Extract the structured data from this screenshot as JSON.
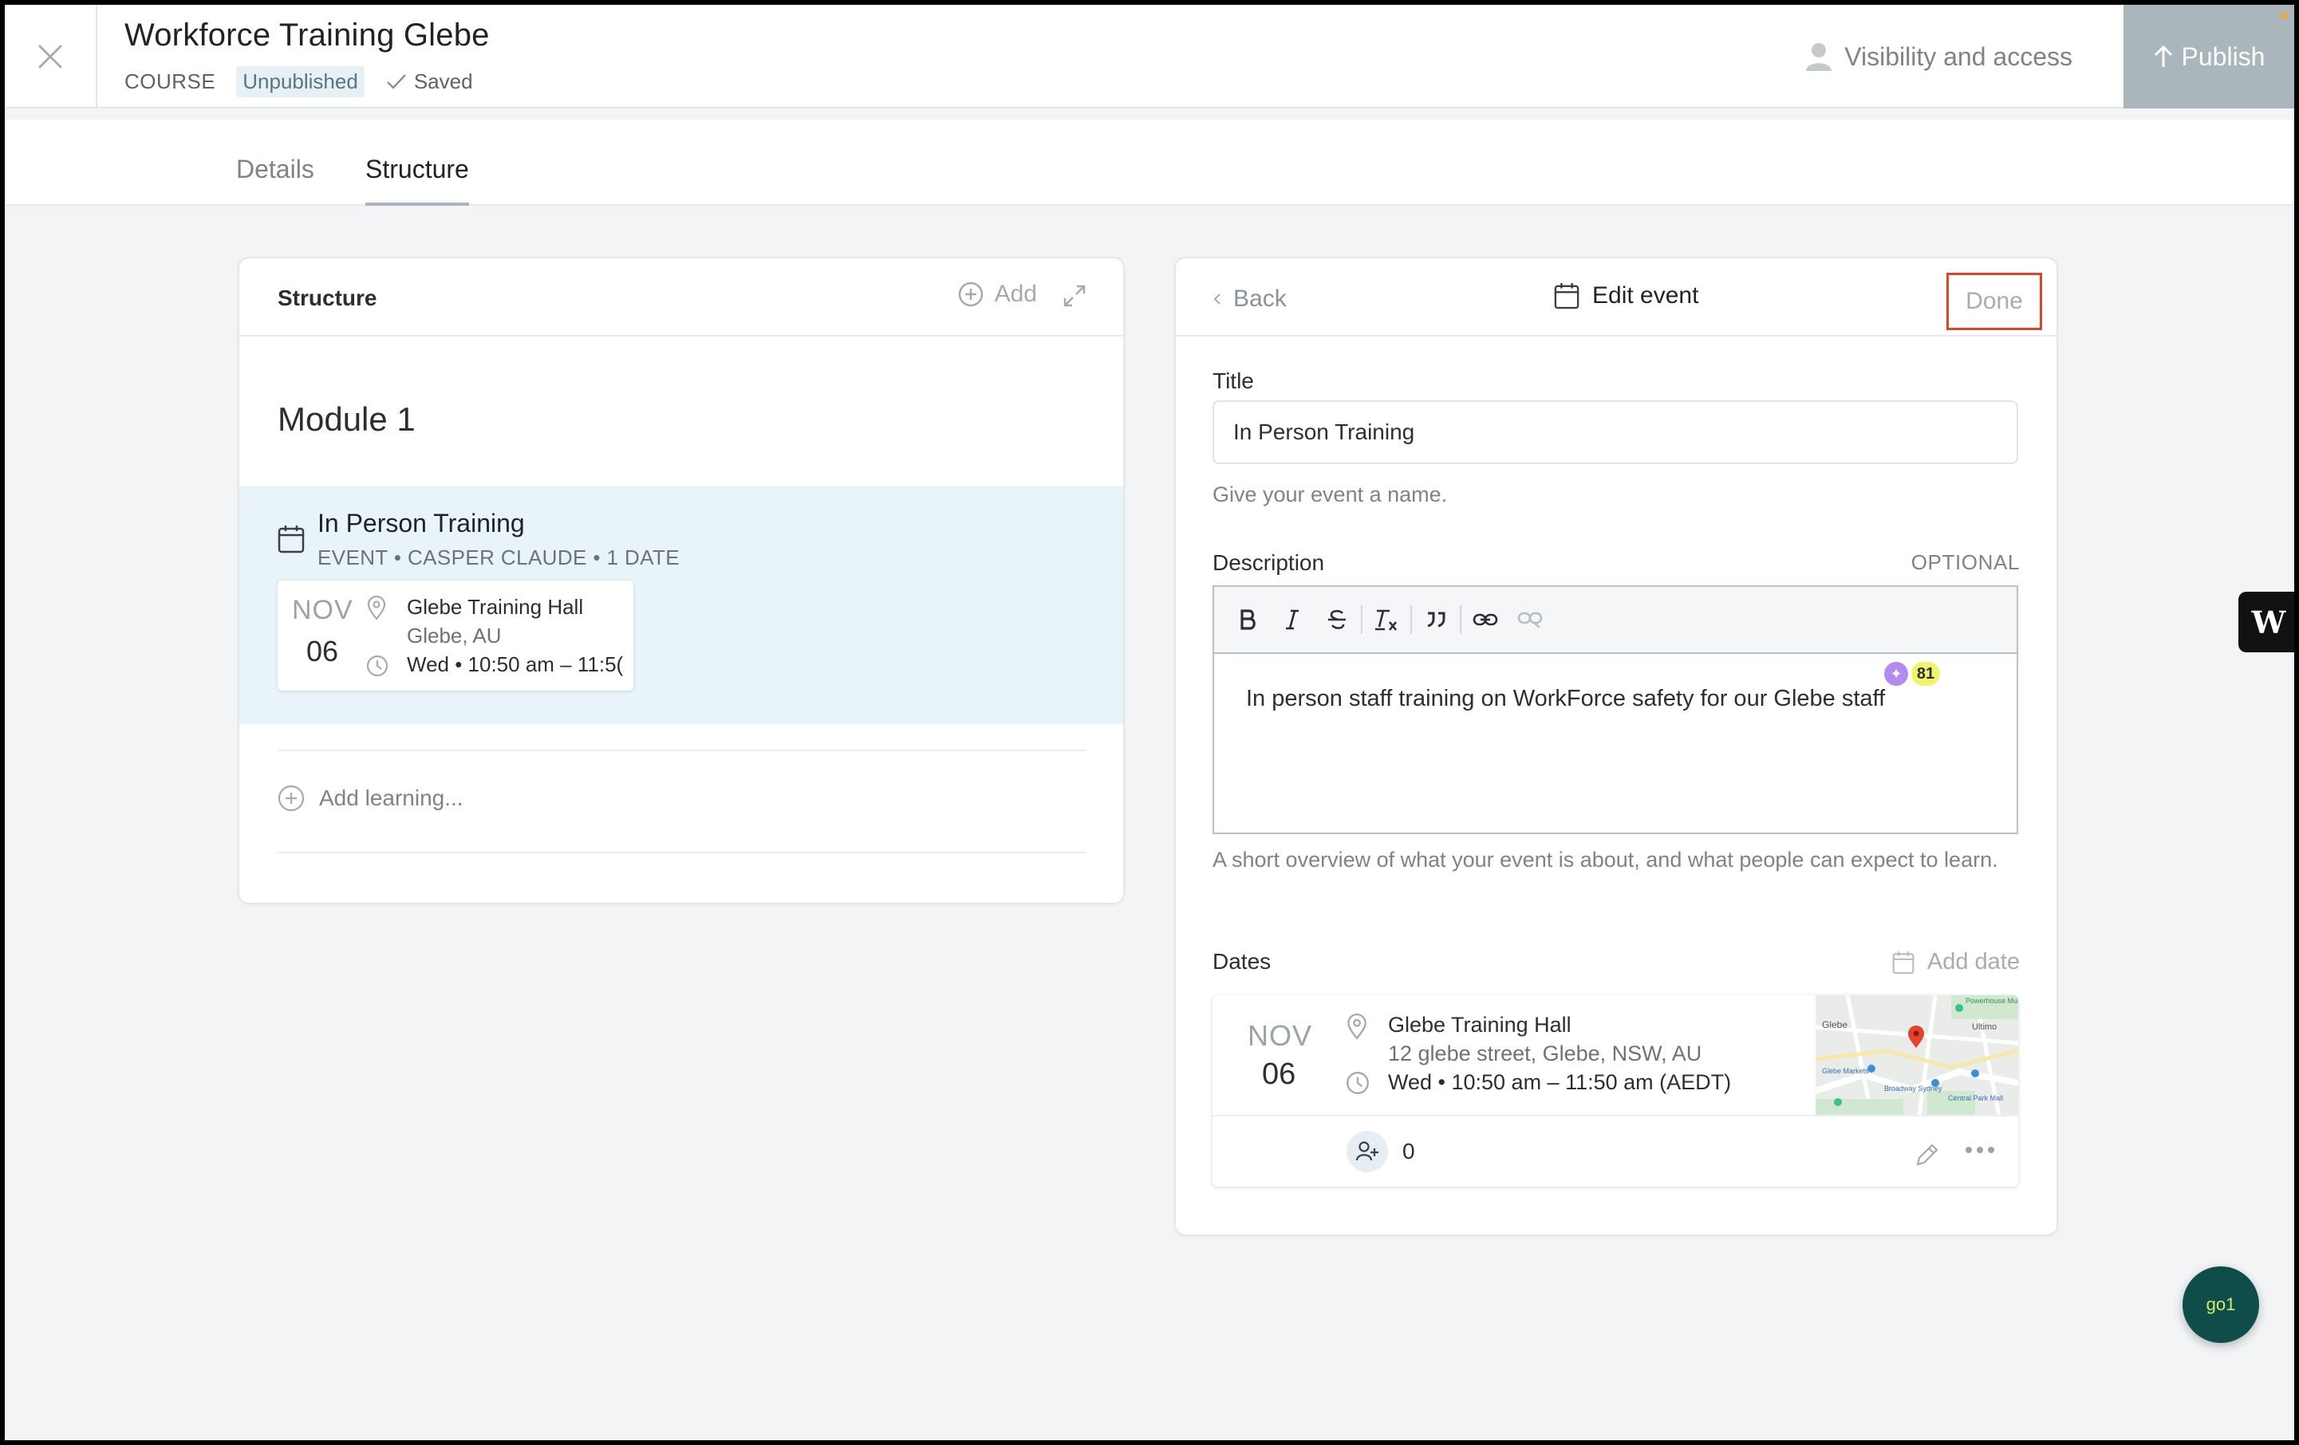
{
  "header": {
    "title": "Workforce Training Glebe",
    "type_label": "COURSE",
    "status": "Unpublished",
    "saved_label": "Saved",
    "visibility_label": "Visibility and access",
    "publish_label": "Publish"
  },
  "tabs": [
    {
      "label": "Details",
      "active": false
    },
    {
      "label": "Structure",
      "active": true
    }
  ],
  "structure": {
    "heading": "Structure",
    "add_label": "Add",
    "module_title": "Module 1",
    "lesson": {
      "title": "In Person Training",
      "subtitle": "EVENT • CASPER CLAUDE • 1 DATE",
      "date_month": "NOV",
      "date_day": "06",
      "venue": "Glebe Training Hall",
      "city": "Glebe, AU",
      "time": "Wed • 10:50 am – 11:5("
    },
    "add_learning_label": "Add learning..."
  },
  "edit_event": {
    "back_label": "Back",
    "heading": "Edit event",
    "done_label": "Done",
    "title_label": "Title",
    "title_value": "In Person Training",
    "title_help": "Give your event a name.",
    "description_label": "Description",
    "description_optional": "OPTIONAL",
    "description_value": "In person staff training on WorkForce safety for our Glebe staff",
    "description_help": "A short overview of what your event is about, and what people can expect to learn.",
    "grammar_count": "81",
    "toolbar": [
      "bold-icon",
      "italic-icon",
      "strikethrough-icon",
      "clear-format-icon",
      "quote-icon",
      "link-icon",
      "unlink-icon"
    ],
    "dates_label": "Dates",
    "add_date_label": "Add date",
    "date": {
      "month": "NOV",
      "day": "06",
      "venue": "Glebe Training Hall",
      "address": "12 glebe street, Glebe, NSW, AU",
      "time": "Wed • 10:50 am – 11:50 am (AEDT)",
      "attendees": "0",
      "map_labels": [
        "Powerhouse Museum",
        "Glebe",
        "Ultimo",
        "Glebe Markets",
        "Broadway Sydney",
        "Central Park Mall"
      ]
    }
  },
  "widgets": {
    "side_logo": "W",
    "fab_label": "go1"
  },
  "colors": {
    "accent_selected_row": "#e8f4fa",
    "done_outline": "#d9452b",
    "publish_bg": "#aab5bc",
    "fab_bg": "#0f4d4a"
  }
}
